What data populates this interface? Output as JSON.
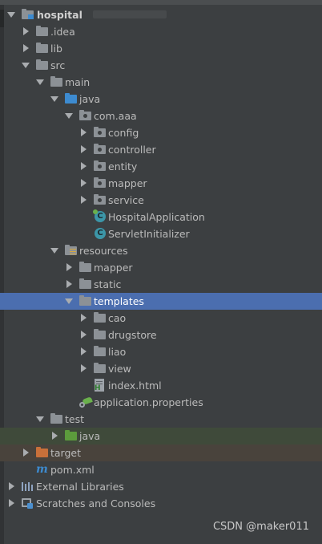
{
  "tree": {
    "root": {
      "label": "hospital",
      "path_hidden": ""
    },
    "idea": "idea_label_placeholder",
    "items": {
      "idea": ".idea",
      "lib": "lib",
      "src": "src",
      "main": "main",
      "java": "java",
      "pkg": "com.aaa",
      "config": "config",
      "controller": "controller",
      "entity": "entity",
      "mapper": "mapper",
      "service": "service",
      "hospital_app": "HospitalApplication",
      "servlet_init": "ServletInitializer",
      "resources": "resources",
      "res_mapper": "mapper",
      "static": "static",
      "templates": "templates",
      "cao": "cao",
      "drugstore": "drugstore",
      "liao": "liao",
      "view": "view",
      "index_html": "index.html",
      "app_props": "application.properties",
      "test": "test",
      "test_java": "java",
      "target": "target",
      "pom": "pom.xml",
      "ext_libs": "External Libraries",
      "scratches": "Scratches and Consoles"
    },
    "selected": "templates"
  },
  "icons": {
    "folder": "folder-icon",
    "source_folder": "source-folder-icon",
    "resources_folder": "resources-folder-icon",
    "test_folder": "test-folder-icon",
    "excluded_folder": "excluded-folder-icon",
    "package": "package-icon",
    "class": "class-icon",
    "html_file": "html-file-icon",
    "properties_file": "spring-properties-icon",
    "maven_file": "maven-icon",
    "libraries": "libraries-icon",
    "scratches": "scratches-icon"
  },
  "colors": {
    "background": "#3c3f41",
    "selected_row": "#4b6eaf",
    "test_row": "#3f4a3a",
    "excluded_row": "#49433c"
  },
  "watermark": "CSDN @maker011"
}
